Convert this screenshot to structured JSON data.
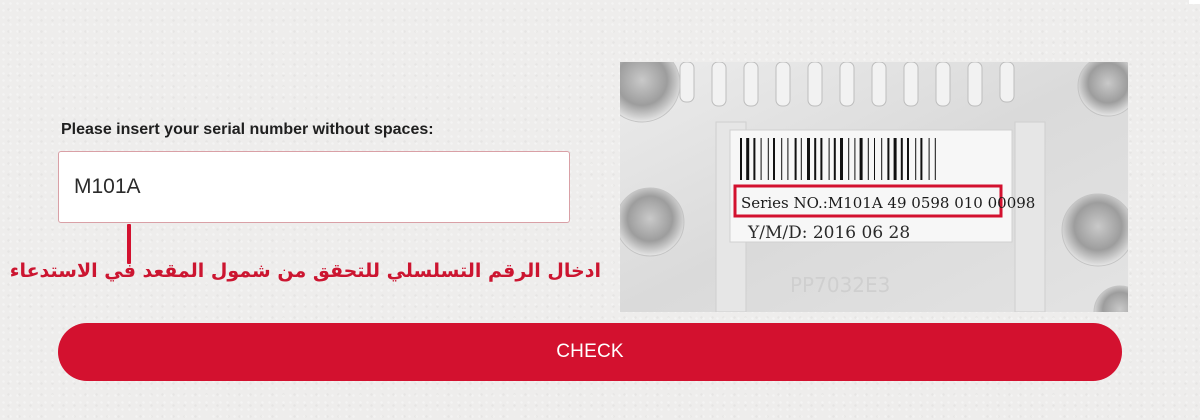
{
  "form": {
    "label": "Please insert your serial number without spaces:",
    "serial_value": "M101A",
    "check_label": "CHECK"
  },
  "annotation": {
    "arabic_text": "ادخال الرقم التسلسلي للتحقق من شمول المقعد في الاستدعاء"
  },
  "photo": {
    "series_text": "Series NO.:M101A 49 0598 010 00098",
    "date_text": "Y/M/D: 2016 06 28",
    "highlight_color": "#d3112f"
  },
  "colors": {
    "accent": "#d3112f",
    "background": "#eeedec"
  }
}
